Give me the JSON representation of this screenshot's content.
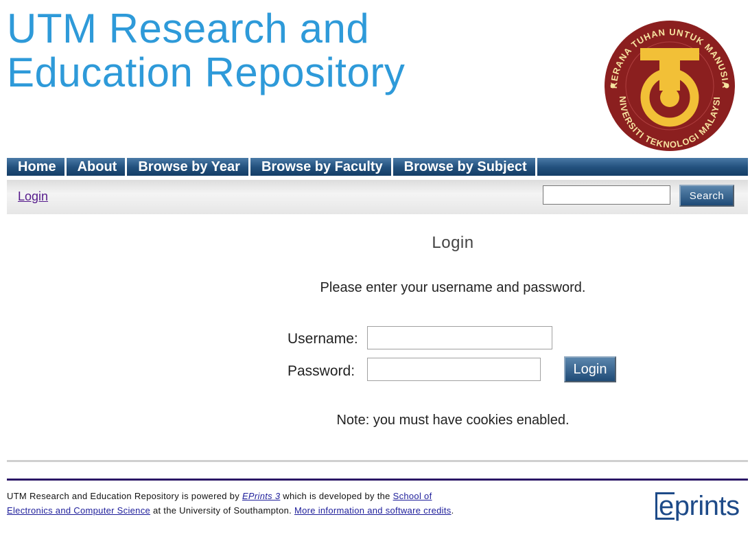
{
  "header": {
    "title_line1": "UTM Research and",
    "title_line2": "Education Repository",
    "logo": {
      "ring_text_top": "KERANA TUHAN UNTUK MANUSIA",
      "ring_text_bottom": "UNIVERSITI TEKNOLOGI MALAYSIA"
    }
  },
  "nav": {
    "items": [
      "Home",
      "About",
      "Browse by Year",
      "Browse by Faculty",
      "Browse by Subject"
    ]
  },
  "subbar": {
    "login_link": "Login",
    "search_value": "",
    "search_button": "Search"
  },
  "main": {
    "heading": "Login",
    "intro": "Please enter your username and password.",
    "username_label": "Username:",
    "password_label": "Password:",
    "username_value": "",
    "password_value": "",
    "login_button": "Login",
    "note": "Note: you must have cookies enabled."
  },
  "footer": {
    "text_part1": "UTM Research and Education Repository is powered by ",
    "eprints_link": "EPrints 3",
    "text_part2": " which is developed by the ",
    "school_link_line1": "School of",
    "school_link_line2": "Electronics and Computer Science",
    "text_part3": " at the University of Southampton. ",
    "credits_link": "More information and software credits",
    "text_part4": ".",
    "logo_e": "e",
    "logo_rest": "prints"
  },
  "colors": {
    "title_blue": "#2e9ad9",
    "nav_blue": "#24527f",
    "logo_maroon": "#8b1f1f",
    "logo_gold": "#f2c037",
    "footer_rule": "#2a1566"
  }
}
